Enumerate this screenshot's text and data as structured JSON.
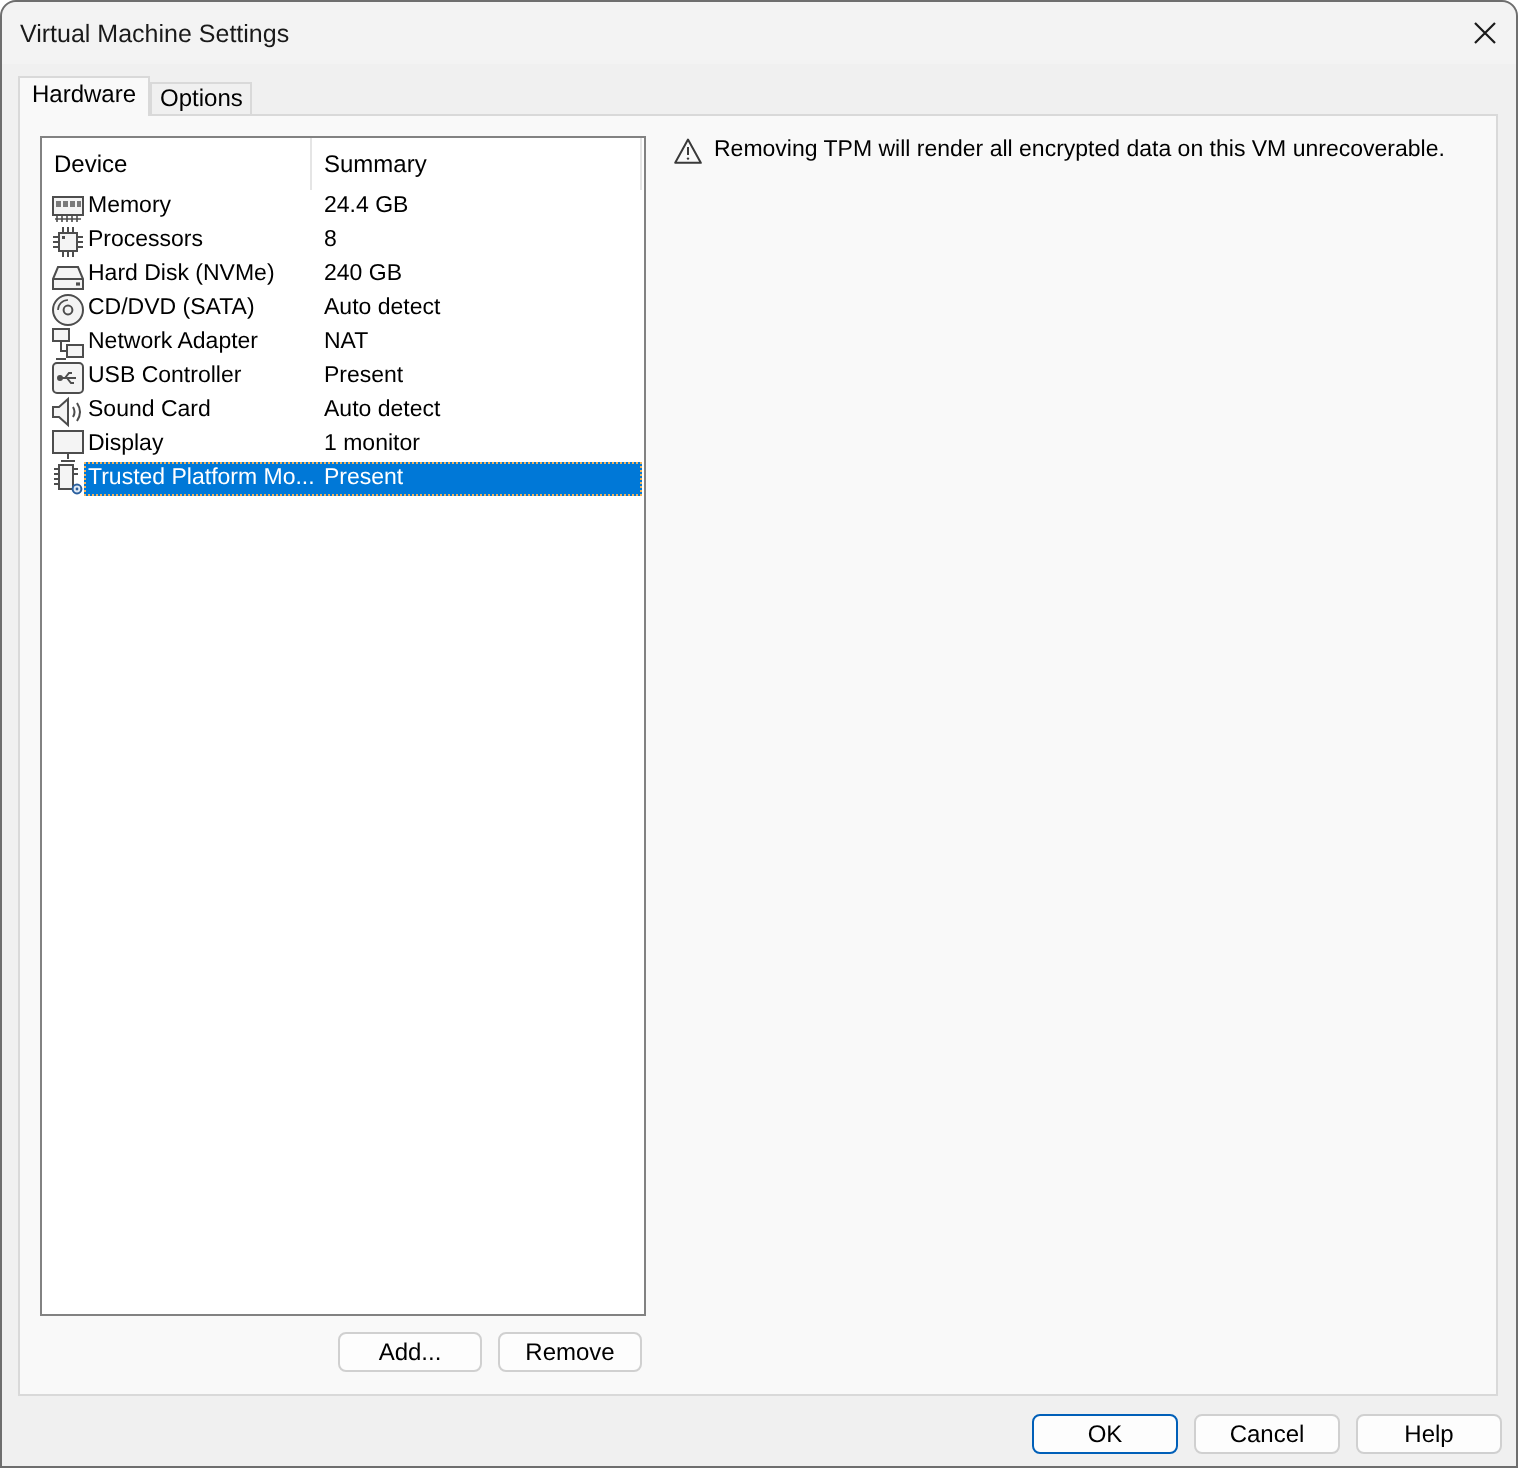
{
  "window": {
    "title": "Virtual Machine Settings"
  },
  "tabs": [
    {
      "label": "Hardware",
      "selected": true
    },
    {
      "label": "Options",
      "selected": false
    }
  ],
  "device_list": {
    "columns": [
      "Device",
      "Summary"
    ],
    "rows": [
      {
        "kind": "memory",
        "device": "Memory",
        "summary": "24.4 GB",
        "selected": false
      },
      {
        "kind": "processor",
        "device": "Processors",
        "summary": "8",
        "selected": false
      },
      {
        "kind": "disk",
        "device": "Hard Disk (NVMe)",
        "summary": "240 GB",
        "selected": false
      },
      {
        "kind": "cdrom",
        "device": "CD/DVD (SATA)",
        "summary": "Auto detect",
        "selected": false
      },
      {
        "kind": "network",
        "device": "Network Adapter",
        "summary": "NAT",
        "selected": false
      },
      {
        "kind": "usb",
        "device": "USB Controller",
        "summary": "Present",
        "selected": false
      },
      {
        "kind": "sound",
        "device": "Sound Card",
        "summary": "Auto detect",
        "selected": false
      },
      {
        "kind": "display",
        "device": "Display",
        "summary": "1 monitor",
        "selected": false
      },
      {
        "kind": "tpm",
        "device": "Trusted Platform Mo...",
        "summary": "Present",
        "selected": true
      }
    ]
  },
  "list_buttons": [
    "Add...",
    "Remove"
  ],
  "warning": {
    "text": "Removing TPM will render all encrypted data on this VM unrecoverable."
  },
  "dialog_buttons": [
    {
      "label": "OK",
      "default": true
    },
    {
      "label": "Cancel",
      "default": false
    },
    {
      "label": "Help",
      "default": false
    }
  ]
}
